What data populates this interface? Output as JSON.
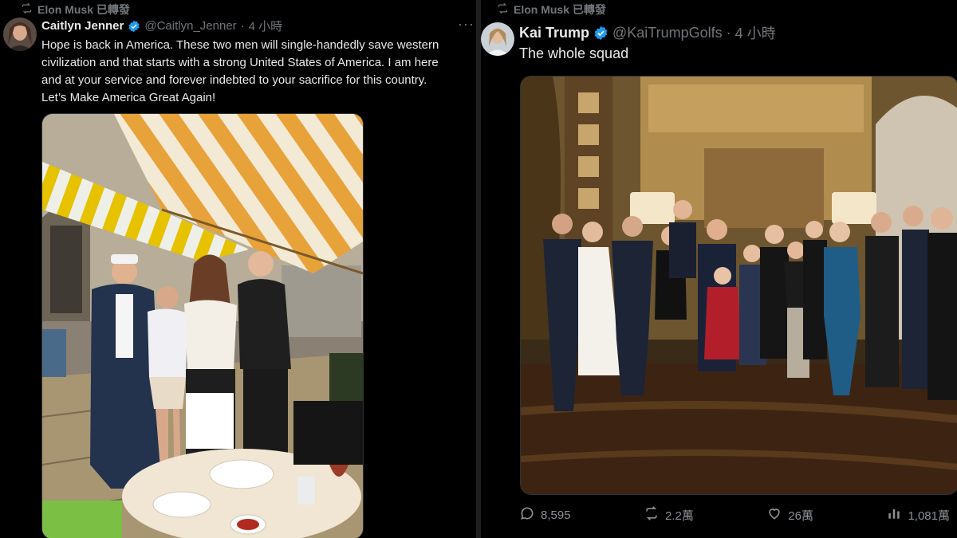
{
  "left": {
    "retweet_label": "Elon Musk 已轉發",
    "author_name": "Caitlyn Jenner",
    "handle": "@Caitlyn_Jenner",
    "separator": "·",
    "time": "4 小時",
    "more": "···",
    "text_lines": [
      "Hope is back in America. These two men will single-handedly save western",
      "civilization and that starts with a strong United States of America. I am here",
      "and at your service and forever indebted to your sacrifice for this country.",
      "Let’s Make America Great Again!"
    ]
  },
  "right": {
    "retweet_label": "Elon Musk 已轉發",
    "author_name": "Kai Trump",
    "handle": "@KaiTrumpGolfs",
    "separator": "·",
    "time": "4 小時",
    "text": "The whole squad",
    "stats": {
      "replies": "8,595",
      "reposts": "2.2萬",
      "likes": "26萬",
      "views": "1,081萬"
    }
  },
  "colors": {
    "background": "#000000",
    "text": "#e7e9ea",
    "muted": "#71767b",
    "verified": "#1d9bf0",
    "awning_stripe": "#e8a23a"
  },
  "icons": [
    "retweet-icon",
    "verified-badge-icon",
    "more-icon",
    "reply-icon",
    "repost-icon",
    "like-icon",
    "views-icon"
  ]
}
